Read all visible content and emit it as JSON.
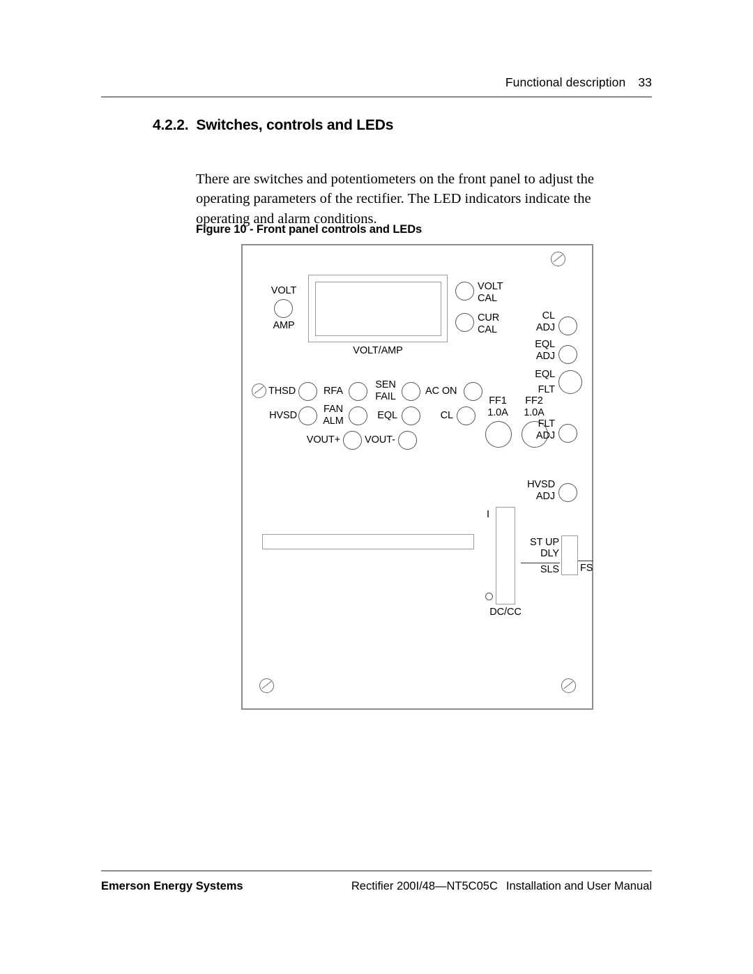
{
  "header": {
    "chapter": "Functional description",
    "page_number": "33"
  },
  "heading": {
    "number": "4.2.2.",
    "title": "Switches, controls and LEDs"
  },
  "body": {
    "paragraph": "There are switches and potentiometers on the front panel to adjust the operating parameters of the rectifier. The LED indicators indicate the operating and alarm conditions."
  },
  "figure": {
    "caption": "Figure 10 - Front panel controls and LEDs",
    "display": {
      "button_top_label": "VOLT",
      "button_bottom_label": "AMP",
      "meter_label": "VOLT/AMP"
    },
    "calibration": [
      {
        "line1": "VOLT",
        "line2": "CAL"
      },
      {
        "line1": "CUR",
        "line2": "CAL"
      }
    ],
    "adjustments": [
      {
        "line1": "CL",
        "line2": "ADJ"
      },
      {
        "line1": "EQL",
        "line2": "ADJ"
      },
      {
        "line1": "EQL",
        "line2": "FLT"
      },
      {
        "line1": "FLT",
        "line2": "ADJ"
      },
      {
        "line1": "HVSD",
        "line2": "ADJ"
      }
    ],
    "leds": [
      {
        "label": "THSD"
      },
      {
        "label": "RFA"
      },
      {
        "line1": "SEN",
        "line2": "FAIL"
      },
      {
        "label": "AC ON"
      },
      {
        "label": "HVSD"
      },
      {
        "line1": "FAN",
        "line2": "ALM"
      },
      {
        "label": "EQL"
      },
      {
        "label": "CL"
      },
      {
        "label": "VOUT+"
      },
      {
        "label": "VOUT-"
      }
    ],
    "fuses": [
      {
        "name": "FF1",
        "rating": "1.0A"
      },
      {
        "name": "FF2",
        "rating": "1.0A"
      }
    ],
    "switches": {
      "dc_cc": {
        "top_label": "I",
        "bottom_label": "DC/CC"
      },
      "startup": {
        "line1": "ST UP",
        "line2": "DLY",
        "left_label": "SLS",
        "right_label": "FS"
      }
    }
  },
  "footer": {
    "company": "Emerson Energy Systems",
    "product": "Rectifier 200I/48—NT5C05C",
    "manual": "Installation and User Manual"
  }
}
